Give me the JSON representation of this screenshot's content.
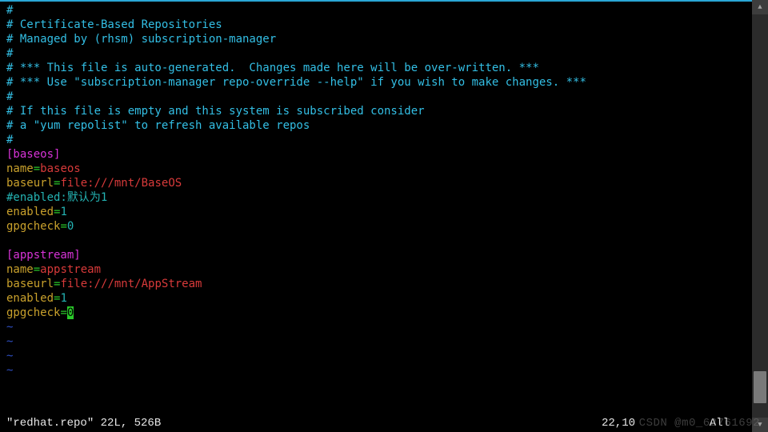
{
  "buffer": {
    "h1": "#",
    "h2": "# Certificate-Based Repositories",
    "h3": "# Managed by (rhsm) subscription-manager",
    "h4": "#",
    "h5": "# *** This file is auto-generated.  Changes made here will be over-written. ***",
    "h6": "# *** Use \"subscription-manager repo-override --help\" if you wish to make changes. ***",
    "h7": "#",
    "h8": "# If this file is empty and this system is subscribed consider",
    "h9": "# a \"yum repolist\" to refresh available repos",
    "h10": "#",
    "s1_header": "[baseos]",
    "s1_name_k": "name",
    "s1_name_eq": "=",
    "s1_name_v": "baseos",
    "s1_url_k": "baseurl",
    "s1_url_eq": "=",
    "s1_url_v": "file:///mnt/BaseOS",
    "s1_comment": "#enabled:默认为1",
    "s1_en_k": "enabled",
    "s1_en_eq": "=",
    "s1_en_v": "1",
    "s1_gpg_k": "gpgcheck",
    "s1_gpg_eq": "=",
    "s1_gpg_v": "0",
    "s2_header": "[appstream]",
    "s2_name_k": "name",
    "s2_name_eq": "=",
    "s2_name_v": "appstream",
    "s2_url_k": "baseurl",
    "s2_url_eq": "=",
    "s2_url_v": "file:///mnt/AppStream",
    "s2_en_k": "enabled",
    "s2_en_eq": "=",
    "s2_en_v": "1",
    "s2_gpg_k": "gpgcheck",
    "s2_gpg_eq": "=",
    "s2_gpg_v": "0",
    "tilde": "~"
  },
  "status": {
    "filename": "\"redhat.repo\" 22L, 526B",
    "position": "22,10",
    "percent": "All"
  },
  "watermark": "CSDN @m0_62761692"
}
